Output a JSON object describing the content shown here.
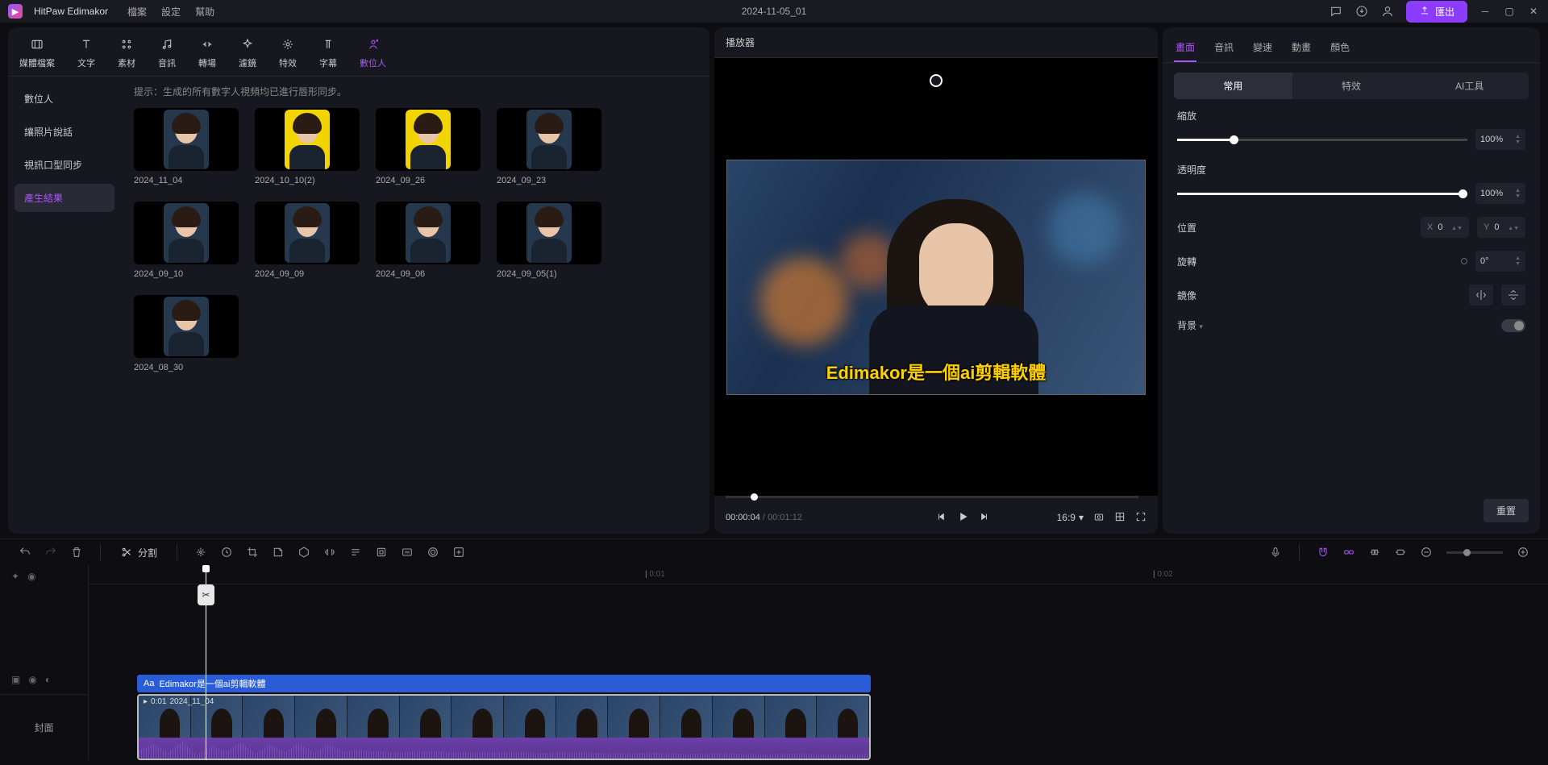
{
  "app_name": "HitPaw Edimakor",
  "menu": [
    "檔案",
    "設定",
    "幫助"
  ],
  "project_name": "2024-11-05_01",
  "export_label": "匯出",
  "tool_tabs": [
    {
      "label": "媒體檔案"
    },
    {
      "label": "文字"
    },
    {
      "label": "素材"
    },
    {
      "label": "音訊"
    },
    {
      "label": "轉場"
    },
    {
      "label": "濾鏡"
    },
    {
      "label": "特效"
    },
    {
      "label": "字幕"
    },
    {
      "label": "數位人"
    }
  ],
  "side_items": [
    "數位人",
    "讓照片說話",
    "視訊口型同步",
    "產生結果"
  ],
  "hint": "提示：生成的所有數字人視頻均已進行唇形同步。",
  "thumbs": [
    "2024_11_04",
    "2024_10_10(2)",
    "2024_09_26",
    "2024_09_23",
    "2024_09_10",
    "2024_09_09",
    "2024_09_06",
    "2024_09_05(1)",
    "2024_08_30"
  ],
  "thumb_bg": [
    "#151515",
    "#f2d400",
    "#f2d400",
    "#151515",
    "#151515",
    "#151515",
    "#151515",
    "#151515",
    "#151515"
  ],
  "preview_title": "播放器",
  "subtitle_text": "Edimakor是一個ai剪輯軟體",
  "time_current": "00:00:04",
  "time_total": "00:01:12",
  "aspect_ratio": "16:9",
  "prop_tabs": [
    "畫面",
    "音訊",
    "變速",
    "動畫",
    "顏色"
  ],
  "sub_tabs": [
    "常用",
    "特效",
    "AI工具"
  ],
  "props": {
    "scale_label": "縮放",
    "scale_value": "100%",
    "opacity_label": "透明度",
    "opacity_value": "100%",
    "position_label": "位置",
    "pos_x": "0",
    "pos_y": "0",
    "x_lbl": "X",
    "y_lbl": "Y",
    "rotate_label": "旋轉",
    "rotate_value": "0°",
    "mirror_label": "鏡像",
    "bg_label": "背景"
  },
  "reset_label": "重置",
  "split_label": "分割",
  "ruler": [
    "0:01",
    "0:02"
  ],
  "text_clip_label": "Edimakor是一個ai剪輯軟體",
  "clip_time": "0:01",
  "clip_name": "2024_11_04",
  "cover_label": "封面"
}
